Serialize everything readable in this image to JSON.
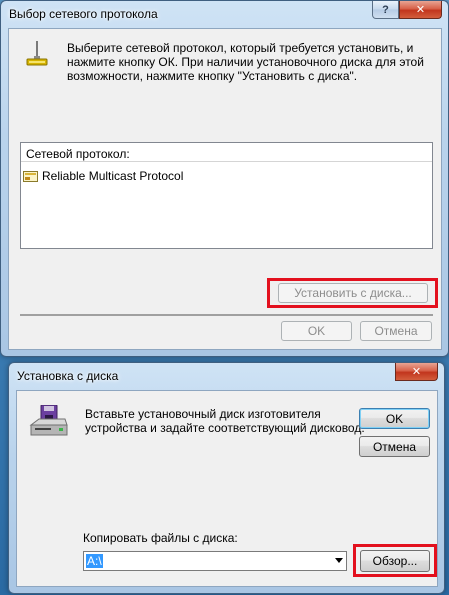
{
  "dialog1": {
    "title": "Выбор сетевого протокола",
    "help_button": "?",
    "close_button": "✕",
    "instruction_line1": "Выберите сетевой протокол, который требуется установить, и",
    "instruction_line2": "нажмите кнопку ОК. При наличии установочного диска для этой",
    "instruction_line3": "возможности, нажмите кнопку \"Установить с диска\".",
    "list_header": "Сетевой протокол:",
    "protocols": [
      {
        "name": "Reliable Multicast Protocol"
      }
    ],
    "have_disk_button": "Установить с диска...",
    "ok_button": "OK",
    "cancel_button": "Отмена"
  },
  "dialog2": {
    "title": "Установка с диска",
    "close_button": "✕",
    "instruction_line1": "Вставьте установочный диск изготовителя",
    "instruction_line2": "устройства и задайте соответствующий дисковод.",
    "ok_button": "OK",
    "cancel_button": "Отмена",
    "copy_from_label": "Копировать файлы с диска:",
    "path_value": "A:\\",
    "browse_button": "Обзор..."
  }
}
